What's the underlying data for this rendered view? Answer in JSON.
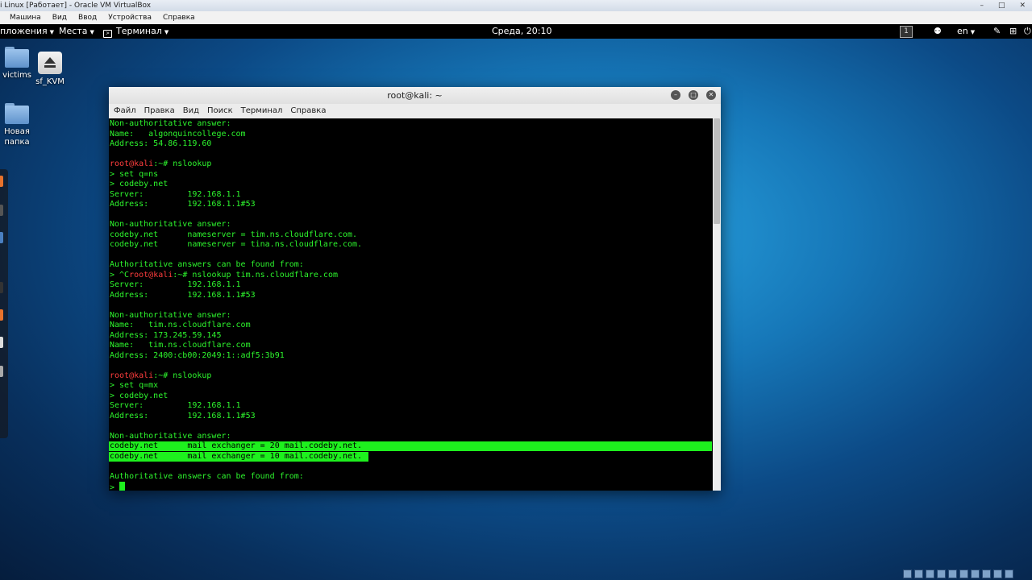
{
  "host": {
    "title": "i Linux [Работает] - Oracle VM VirtualBox",
    "menu": [
      "Машина",
      "Вид",
      "Ввод",
      "Устройства",
      "Справка"
    ]
  },
  "panel": {
    "apps": "пложения",
    "places": "Места",
    "terminal": "Терминал",
    "clock": "Среда, 20:10",
    "workspace": "1",
    "lang": "en"
  },
  "desktop": {
    "icons": [
      "victims",
      "sf_KVM",
      "Новая папка"
    ]
  },
  "window": {
    "title": "root@kali: ~",
    "menu": [
      "Файл",
      "Правка",
      "Вид",
      "Поиск",
      "Терминал",
      "Справка"
    ]
  },
  "terminal": {
    "lines": [
      "Non-authoritative answer:",
      "Name:   algonquincollege.com",
      "Address: 54.86.119.60",
      "",
      "root@kali:~# nslookup",
      "> set q=ns",
      "> codeby.net",
      "Server:         192.168.1.1",
      "Address:        192.168.1.1#53",
      "",
      "Non-authoritative answer:",
      "codeby.net      nameserver = tim.ns.cloudflare.com.",
      "codeby.net      nameserver = tina.ns.cloudflare.com.",
      "",
      "Authoritative answers can be found from:",
      "> ^Croot@kali:~# nslookup tim.ns.cloudflare.com",
      "Server:         192.168.1.1",
      "Address:        192.168.1.1#53",
      "",
      "Non-authoritative answer:",
      "Name:   tim.ns.cloudflare.com",
      "Address: 173.245.59.145",
      "Name:   tim.ns.cloudflare.com",
      "Address: 2400:cb00:2049:1::adf5:3b91",
      "",
      "root@kali:~# nslookup",
      "> set q=mx",
      "> codeby.net",
      "Server:         192.168.1.1",
      "Address:        192.168.1.1#53",
      "",
      "Non-authoritative answer:",
      "codeby.net      mail exchanger = 20 mail.codeby.net.",
      "codeby.net      mail exchanger = 10 mail.codeby.net.",
      "",
      "Authoritative answers can be found from:",
      "> "
    ],
    "prompt_lines": [
      4,
      15,
      25
    ],
    "highlight_lines": [
      32,
      33
    ],
    "cursor_line": 36
  },
  "colors": {
    "text": "#2df52d",
    "prompt": "#ff3d3d",
    "selection": "#1ef01e",
    "background": "#000000"
  }
}
